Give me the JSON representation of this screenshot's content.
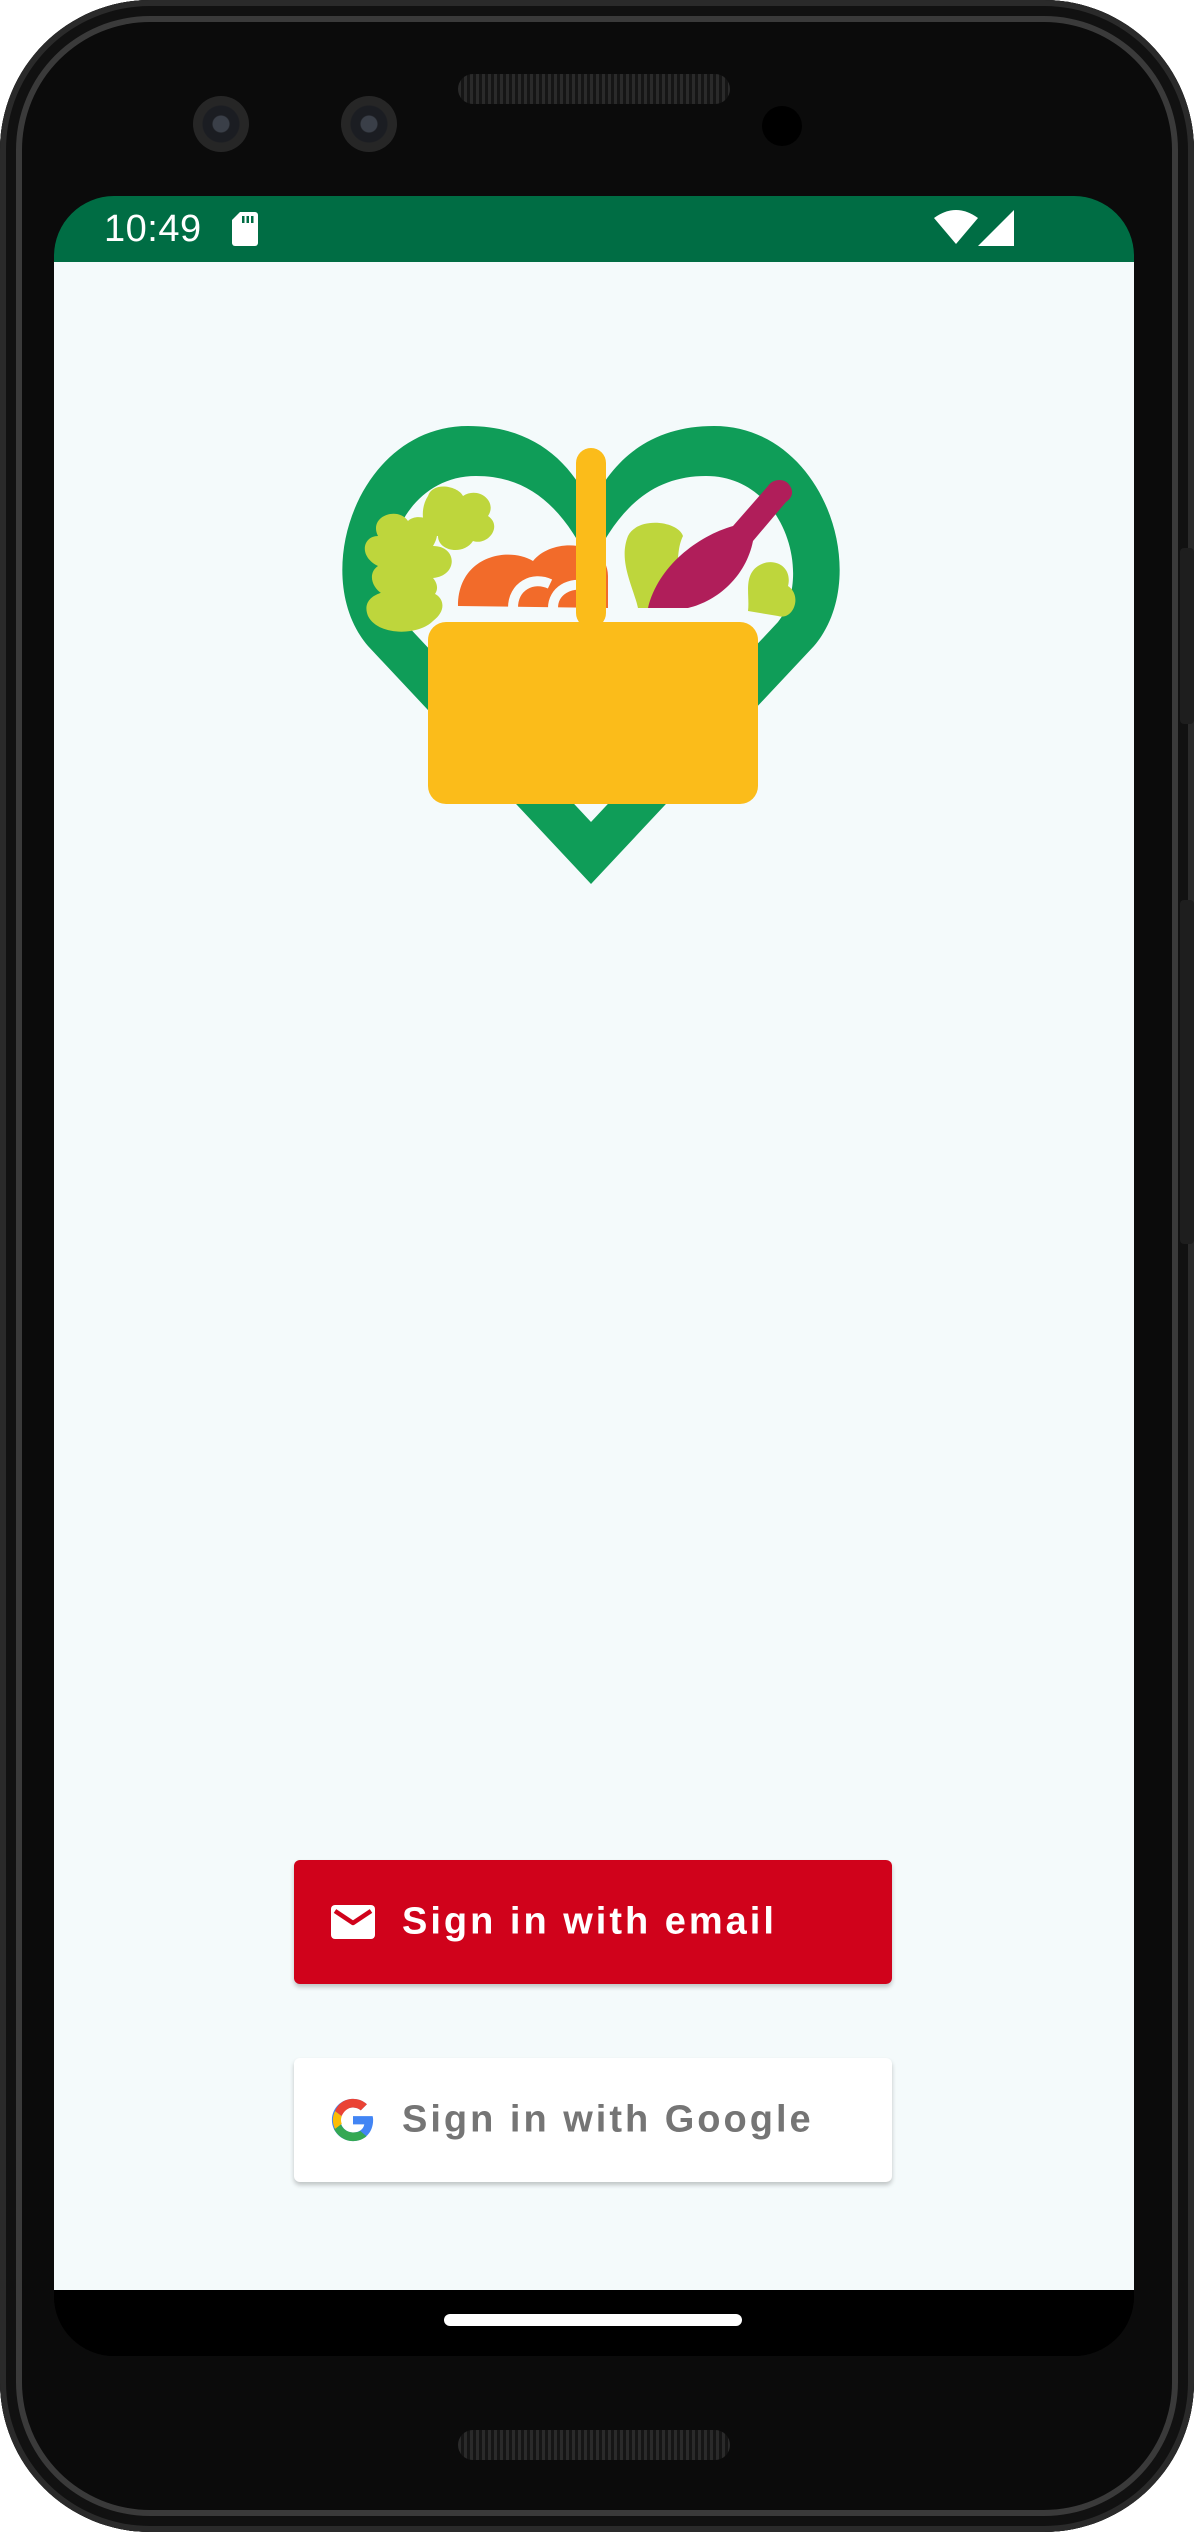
{
  "status_bar": {
    "time": "10:49",
    "icons": [
      "sd-card-icon",
      "wifi-icon",
      "cell-signal-icon"
    ],
    "background_color": "#006d44"
  },
  "logo": {
    "icon": "heart-grocery-basket-icon",
    "colors": {
      "heart": "#0f9d58",
      "basket": "#fbbc1a",
      "greens": "#bed63c",
      "tomato": "#f26b2a",
      "bottle": "#b01e5a"
    }
  },
  "auth": {
    "email_button": {
      "label": "Sign in with email",
      "icon": "mail-icon",
      "background_color": "#d0021b"
    },
    "google_button": {
      "label": "Sign in with Google",
      "icon": "google-g-icon",
      "background_color": "#ffffff"
    }
  },
  "nav_bar": {
    "gesture": "home-handle"
  }
}
